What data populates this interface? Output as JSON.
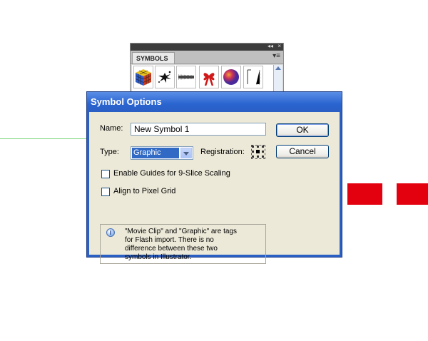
{
  "panel": {
    "title": "SYMBOLS",
    "collapse_glyph": "◂◂",
    "close_glyph": "×",
    "menu_glyph": "▾≡",
    "symbols": [
      "rubiks-cube-symbol",
      "ink-splat-symbol",
      "grunge-brush-symbol",
      "red-ribbon-bow-symbol",
      "gradient-sphere-symbol",
      "frame-brush-symbol"
    ]
  },
  "dialog": {
    "title": "Symbol Options",
    "name_label": "Name:",
    "name_value": "New Symbol 1",
    "type_label": "Type:",
    "type_value": "Graphic",
    "registration_label": "Registration:",
    "ok_label": "OK",
    "cancel_label": "Cancel",
    "guides_checkbox_label": "Enable Guides for 9-Slice Scaling",
    "guides_checked": false,
    "pixel_grid_label": "Align to Pixel Grid",
    "pixel_grid_checked": false,
    "info_icon_glyph": "i",
    "info_text": "\"Movie Clip\" and \"Graphic\" are tags\nfor Flash import. There is no\ndifference between these two\nsymbols in Illustrator."
  },
  "colors": {
    "title_bar": "#2a5fc4",
    "dialog_bg": "#ece9d8",
    "red_shape": "#e3000f",
    "guide_green": "#7fd67f",
    "selection": "#316ac5"
  }
}
